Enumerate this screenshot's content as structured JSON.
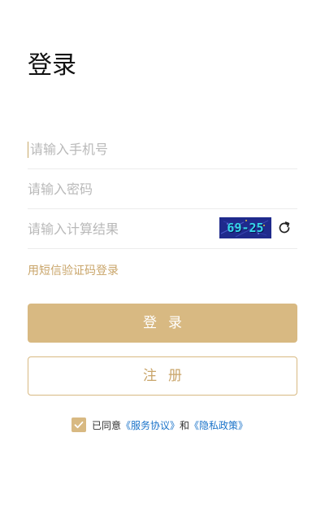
{
  "header": {
    "title": "登录"
  },
  "form": {
    "phone_placeholder": "请输入手机号",
    "password_placeholder": "请输入密码",
    "calc_placeholder": "请输入计算结果",
    "captcha_text": "69-25"
  },
  "links": {
    "sms_login": "用短信验证码登录"
  },
  "buttons": {
    "login": "登录",
    "register": "注册"
  },
  "agreement": {
    "checked": true,
    "prefix": "已同意",
    "service": "《服务协议》",
    "and": "和",
    "privacy": "《隐私政策》"
  },
  "icons": {
    "refresh": "refresh-icon",
    "check": "check-icon"
  },
  "colors": {
    "accent": "#d8b982",
    "accent_text": "#c9a56a",
    "link": "#1a73c9",
    "captcha_bg": "#1f2a8c",
    "captcha_text": "#36d6e8"
  }
}
